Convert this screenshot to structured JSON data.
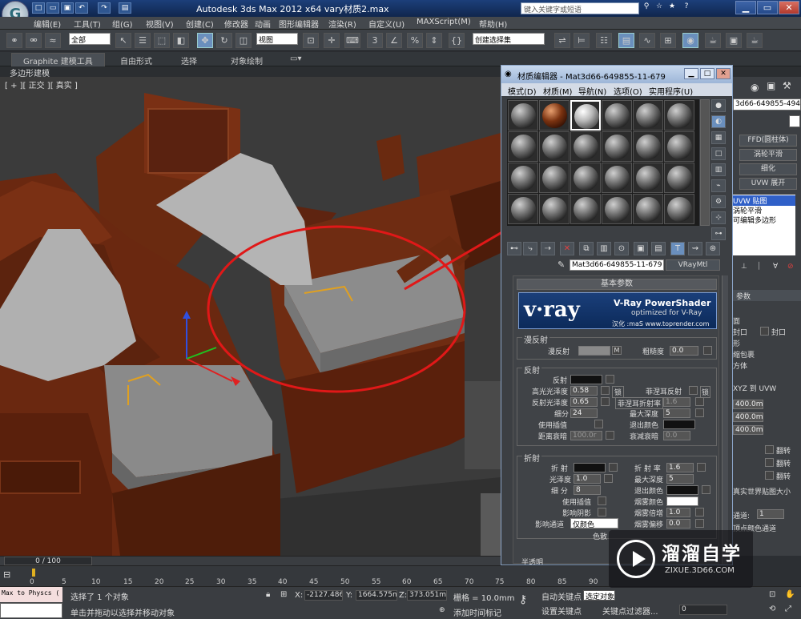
{
  "app": {
    "title": "Autodesk 3ds Max  2012 x64      vary材质2.max",
    "search_placeholder": "键入关键字或短语",
    "logo_letter": "G"
  },
  "menubar": [
    "编辑(E)",
    "工具(T)",
    "组(G)",
    "视图(V)",
    "创建(C)",
    "修改器",
    "动画",
    "图形编辑器",
    "渲染(R)",
    "自定义(U)",
    "MAXScript(M)",
    "帮助(H)"
  ],
  "toolbar": {
    "selection_filter": "全部",
    "reference_coord": "视图",
    "named_selection": "创建选择集",
    "spinner_snap": "2.5",
    "percent_snap": "%"
  },
  "ribbon": {
    "tabs": [
      "Graphite 建模工具",
      "自由形式",
      "选择",
      "对象绘制"
    ],
    "subpanel": "多边形建模"
  },
  "viewport": {
    "label": "[ + ][ 正交 ][ 真实 ]"
  },
  "material_editor": {
    "title": "材质编辑器 - Mat3d66-649855-11-679",
    "menu": [
      "模式(D)",
      "材质(M)",
      "导航(N)",
      "选项(O)",
      "实用程序(U)"
    ],
    "material_name": "Mat3d66-649855-11-679",
    "material_type": "VRayMtl",
    "rollout_basic": "基本参数",
    "vray_logo": "v·ray",
    "vray_product": "V-Ray PowerShader",
    "vray_optimized": "optimized for V-Ray",
    "vray_credit": "汉化 :maS  www.toprender.com",
    "diffuse": {
      "group": "漫反射",
      "diffuse_label": "漫反射",
      "map_btn": "M",
      "roughness_label": "粗糙度",
      "roughness": "0.0"
    },
    "reflection": {
      "group": "反射",
      "reflect_label": "反射",
      "hilight_gloss_label": "高光光泽度",
      "hilight_gloss": "0.58",
      "lock_label": "锁",
      "fresnel_label": "菲涅耳反射",
      "lock2_label": "锁",
      "refl_gloss_label": "反射光泽度",
      "refl_gloss": "0.65",
      "fresnel_ior_label": "菲涅耳折射率",
      "fresnel_ior": "1.6",
      "subdivs_label": "细分",
      "subdivs": "24",
      "max_depth_label": "最大深度",
      "max_depth": "5",
      "use_interp_label": "使用插值",
      "exit_color_label": "退出颜色",
      "dim_dist_label": "距离衰暗",
      "dim_dist": "100.0r",
      "dim_falloff_label": "衰减衰暗",
      "dim_falloff": "0.0"
    },
    "refraction": {
      "group": "折射",
      "refract_label": "折 射",
      "ior_label": "折 射 率",
      "ior": "1.6",
      "gloss_label": "光泽度",
      "gloss": "1.0",
      "max_depth_label": "最大深度",
      "max_depth": "5",
      "subdivs_label": "细 分",
      "subdivs": "8",
      "exit_color_label": "退出颜色",
      "use_interp_label": "使用插值",
      "fog_color_label": "烟雾颜色",
      "affect_shadows_label": "影响阴影",
      "fog_mult_label": "烟雾倍增",
      "fog_mult": "1.0",
      "affect_channels_label": "影响通道",
      "affect_channels": "仅颜色",
      "fog_bias_label": "烟雾偏移",
      "fog_bias": "0.0",
      "dispersion_label": "色散"
    },
    "translucency_label": "半透明"
  },
  "command_panel": {
    "object_name": "3d66-649855-494-427",
    "buttons": [
      "FFD(圆柱体)",
      "涡轮平滑",
      "细化",
      "UVW 展开"
    ],
    "stack": [
      "UVW 贴图",
      "涡轮平滑",
      "可编辑多边形"
    ],
    "params_header": "参数",
    "options": [
      "面",
      "封口",
      "形",
      "缩包裹",
      "方体"
    ],
    "xyz_uvw": "XYZ 到 UVW",
    "values": [
      "400.0m",
      "400.0m",
      "400.0m"
    ],
    "flip_label": "翻转",
    "real_world_label": "真实世界贴图大小",
    "channel_label": "通道:",
    "channel_value": "1",
    "vertex_color_label": "顶点颜色通道"
  },
  "timeline": {
    "frame_display": "0 / 100",
    "ticks": [
      "0",
      "5",
      "10",
      "15",
      "20",
      "25",
      "30",
      "35",
      "40",
      "45",
      "50",
      "55",
      "60",
      "65",
      "70",
      "75",
      "80",
      "85",
      "90"
    ]
  },
  "status": {
    "maxscript": "Max to Physcs (",
    "selection": "选择了 1 个对象",
    "prompt": "单击并拖动以选择并移动对象",
    "x_label": "X:",
    "x": "-2127.486",
    "y_label": "Y:",
    "y": "1664.575m",
    "z_label": "Z:",
    "z": "373.051mr",
    "grid": "栅格 = 10.0mm",
    "add_time_tag": "添加时间标记",
    "auto_key": "自动关键点",
    "auto_key_value": "选定对象",
    "set_key": "设置关键点",
    "key_filter": "关键点过滤器...",
    "frame": "0"
  },
  "watermark": {
    "title": "溜溜自学",
    "url": "ZIXUE.3D66.COM"
  },
  "colors": {
    "titlebar": "#1c3f7a",
    "annotation_red": "#e01818",
    "vray_blue": "#1a3f7a",
    "selection_blue": "#3060c8"
  }
}
